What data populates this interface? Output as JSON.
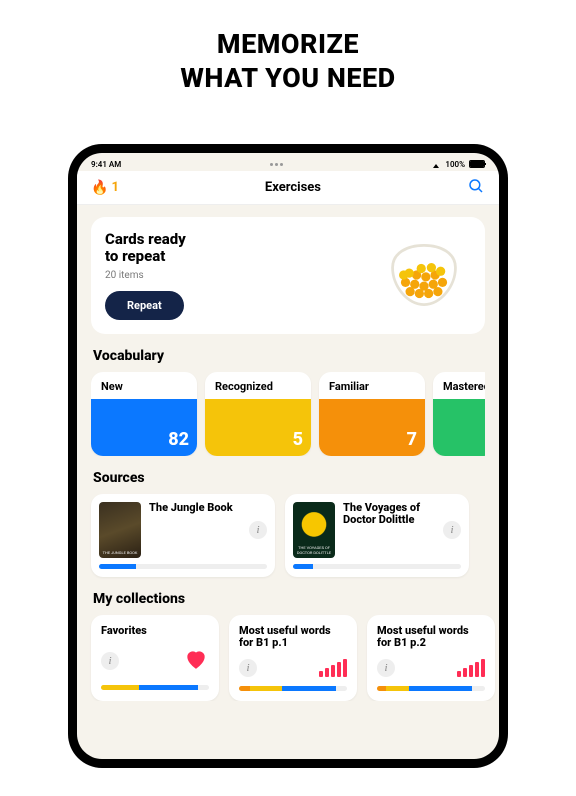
{
  "promo": {
    "line1": "MEMORIZE",
    "line2": "WHAT YOU NEED"
  },
  "status": {
    "time": "9:41 AM",
    "battery": "100%"
  },
  "topbar": {
    "streak": "1",
    "title": "Exercises"
  },
  "ready": {
    "title1": "Cards ready",
    "title2": "to repeat",
    "sub": "20 items",
    "button": "Repeat"
  },
  "sections": {
    "vocab": "Vocabulary",
    "sources": "Sources",
    "collections": "My collections"
  },
  "vocab": [
    {
      "label": "New",
      "count": "82",
      "color": "#0b78ff"
    },
    {
      "label": "Recognized",
      "count": "5",
      "color": "#f5c40a"
    },
    {
      "label": "Familiar",
      "count": "7",
      "color": "#f5900a"
    },
    {
      "label": "Mastered",
      "count": "",
      "color": "#26c267"
    }
  ],
  "sources": [
    {
      "title": "The Jungle Book",
      "cover": "THE JUNGLE BOOK",
      "progress": 22,
      "color": "#0b78ff"
    },
    {
      "title": "The Voyages of Doctor Dolittle",
      "cover": "THE VOYAGES OF DOCTOR DOLITTLE",
      "progress": 12,
      "color": "#0b78ff"
    }
  ],
  "collections": [
    {
      "title": "Favorites",
      "type": "heart",
      "segments": [
        [
          "#f5c40a",
          35
        ],
        [
          "#0b78ff",
          55
        ]
      ]
    },
    {
      "title": "Most useful words for B1 p.1",
      "type": "signal",
      "segments": [
        [
          "#f5900a",
          10
        ],
        [
          "#f5c40a",
          30
        ],
        [
          "#0b78ff",
          50
        ]
      ]
    },
    {
      "title": "Most useful words for B1 p.2",
      "type": "signal",
      "segments": [
        [
          "#f5900a",
          8
        ],
        [
          "#f5c40a",
          22
        ],
        [
          "#0b78ff",
          58
        ]
      ]
    }
  ]
}
